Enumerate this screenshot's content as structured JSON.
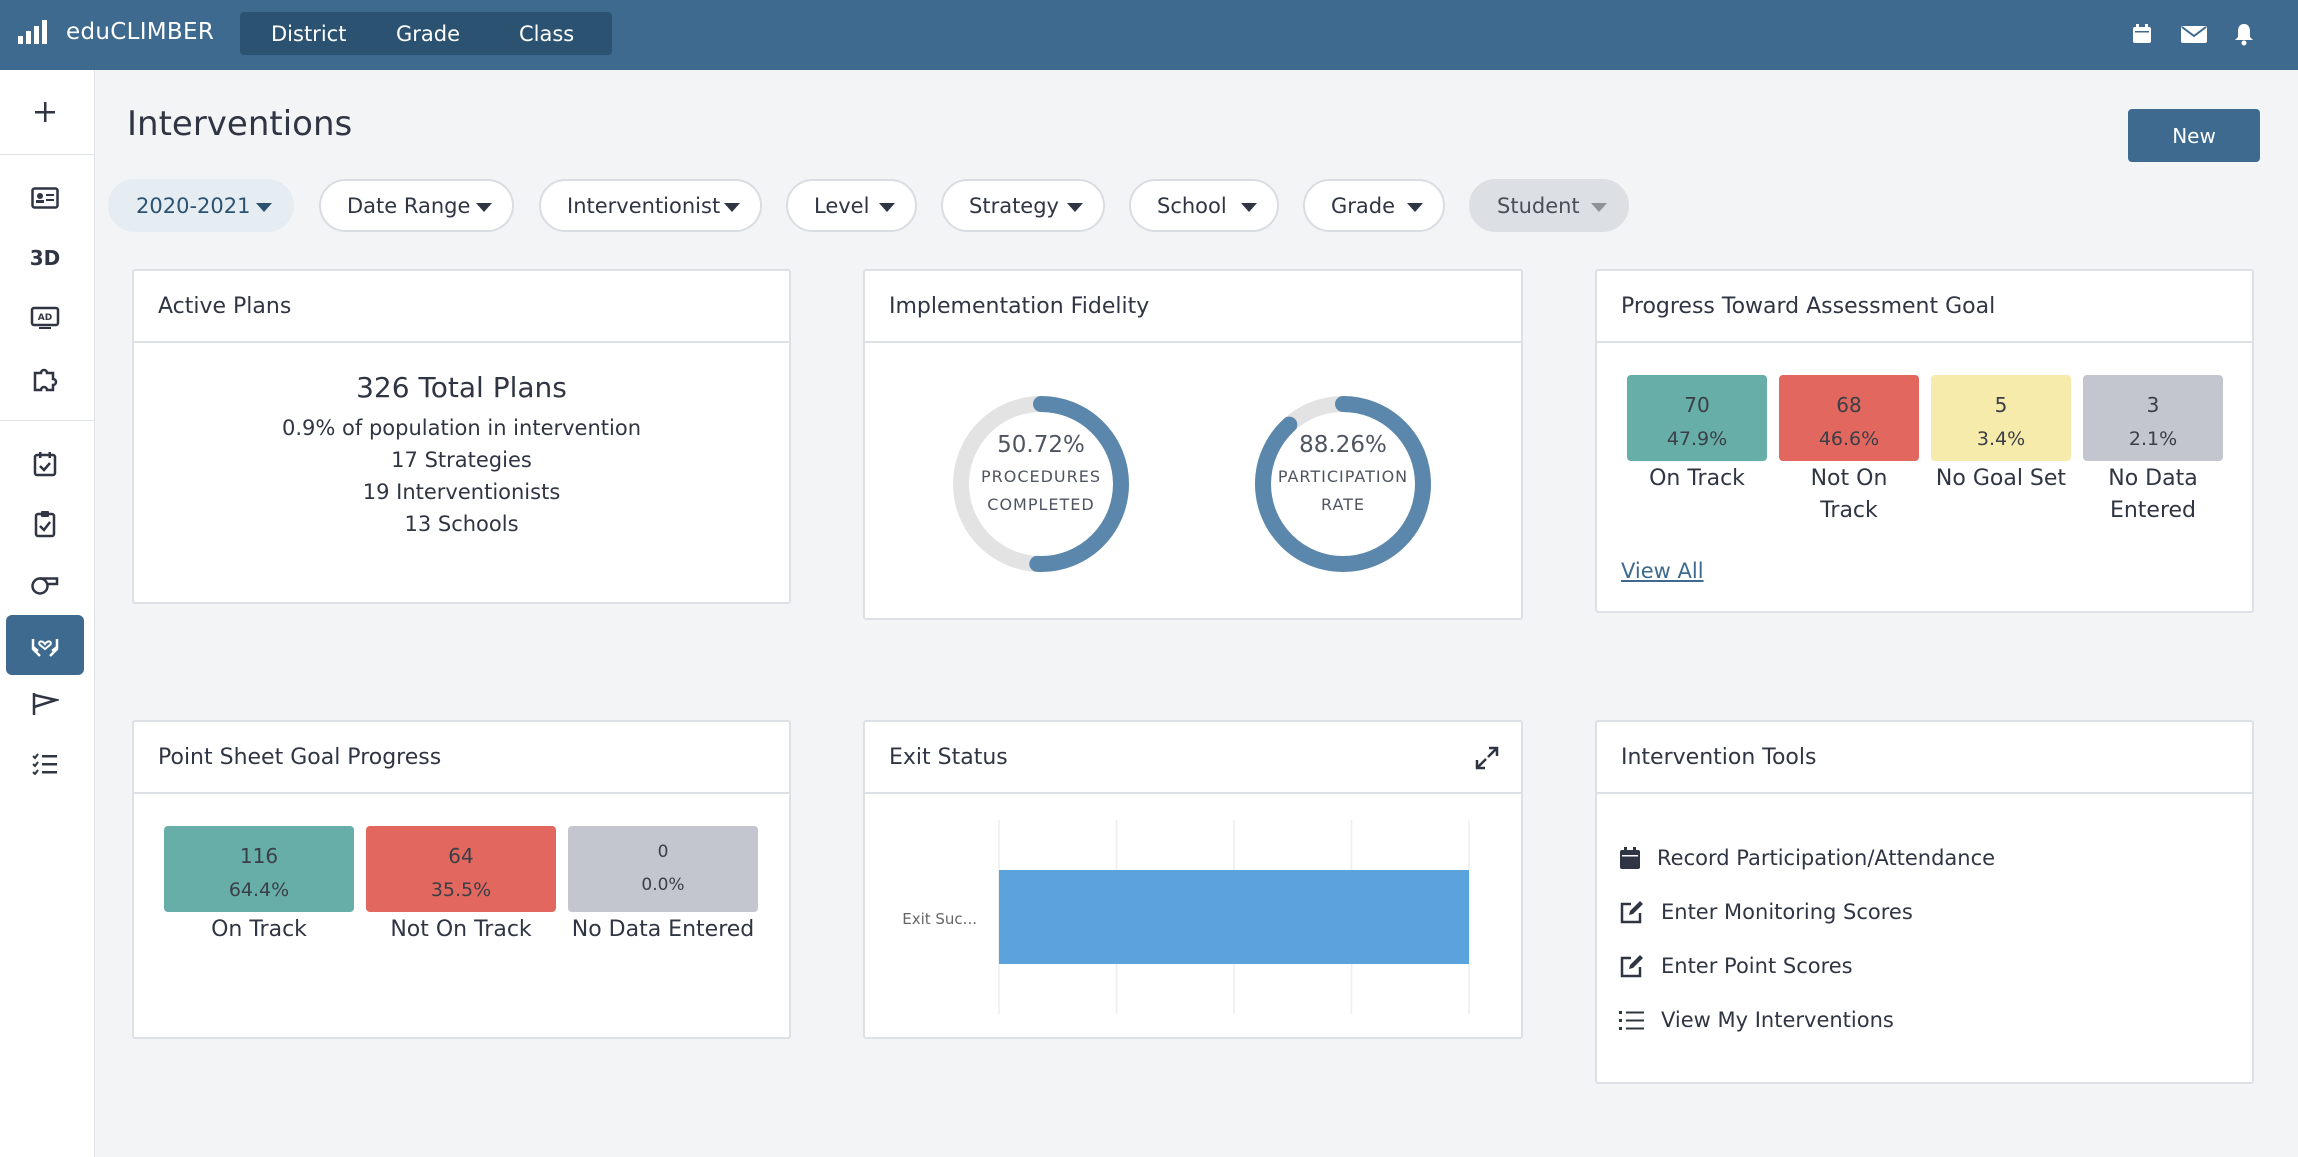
{
  "app": {
    "brand": "eduCLIMBER",
    "scope_tabs": [
      "District",
      "Grade",
      "Class"
    ],
    "top_icons": [
      "calendar-icon",
      "mail-icon",
      "bell-icon"
    ]
  },
  "sidebar": {
    "items": [
      {
        "name": "add",
        "icon": "plus-icon"
      },
      {
        "name": "student-profile",
        "icon": "id-card-icon"
      },
      {
        "name": "3d",
        "label": "3D"
      },
      {
        "name": "ad-display",
        "icon": "ad-screen-icon"
      },
      {
        "name": "puzzle",
        "icon": "puzzle-icon"
      },
      {
        "name": "calendar",
        "icon": "calendar-check-icon"
      },
      {
        "name": "clipboard",
        "icon": "clipboard-icon"
      },
      {
        "name": "whistle",
        "icon": "whistle-icon"
      },
      {
        "name": "interventions",
        "icon": "hands-heart-icon",
        "active": true
      },
      {
        "name": "flag",
        "icon": "flag-icon"
      },
      {
        "name": "checklist",
        "icon": "checklist-icon"
      }
    ]
  },
  "header": {
    "title": "Interventions",
    "new_label": "New"
  },
  "filters": {
    "year": "2020-2021",
    "date_range": "Date Range",
    "interventionist": "Interventionist",
    "level": "Level",
    "strategy": "Strategy",
    "school": "School",
    "grade": "Grade",
    "student": "Student"
  },
  "active_plans": {
    "title": "Active Plans",
    "total": "326 Total Plans",
    "lines": [
      "0.9% of population in intervention",
      "17 Strategies",
      "19 Interventionists",
      "13 Schools"
    ]
  },
  "fidelity": {
    "title": "Implementation Fidelity",
    "donuts": [
      {
        "value": 50.72,
        "pct": "50.72%",
        "line1": "PROCEDURES",
        "line2": "COMPLETED"
      },
      {
        "value": 88.26,
        "pct": "88.26%",
        "line1": "PARTICIPATION",
        "line2": "RATE"
      }
    ],
    "colors": {
      "fill": "#5b87ac",
      "track": "#e3e3e3"
    }
  },
  "assessment": {
    "title": "Progress Toward Assessment Goal",
    "items": [
      {
        "count": "70",
        "pct": "47.9%",
        "label_1": "On Track",
        "label_2": "",
        "color": "#67ada8"
      },
      {
        "count": "68",
        "pct": "46.6%",
        "label_1": "Not On",
        "label_2": "Track",
        "color": "#e2675e"
      },
      {
        "count": "5",
        "pct": "3.4%",
        "label_1": "No Goal Set",
        "label_2": "",
        "color": "#f7ebab"
      },
      {
        "count": "3",
        "pct": "2.1%",
        "label_1": "No Data",
        "label_2": "Entered",
        "color": "#c3c5cf"
      }
    ],
    "view_all": "View All"
  },
  "point_sheet": {
    "title": "Point Sheet Goal Progress",
    "items": [
      {
        "count": "116",
        "pct": "64.4%",
        "label": "On Track",
        "color": "#67ada8"
      },
      {
        "count": "64",
        "pct": "35.5%",
        "label": "Not On Track",
        "color": "#e2675e"
      },
      {
        "count": "0",
        "pct": "0.0%",
        "label": "No Data Entered",
        "color": "#c3c5cf"
      }
    ]
  },
  "exit_status": {
    "title": "Exit Status",
    "expand_icon": "expand-icon"
  },
  "chart_data": {
    "type": "bar",
    "orientation": "horizontal",
    "categories": [
      "Exit Suc..."
    ],
    "values": [
      1
    ],
    "xlim": [
      0,
      1
    ],
    "grid": true,
    "color": "#5ba3dc"
  },
  "tools": {
    "title": "Intervention Tools",
    "items": [
      {
        "label": "Record Participation/Attendance",
        "icon": "calendar-icon"
      },
      {
        "label": "Enter Monitoring Scores",
        "icon": "edit-icon"
      },
      {
        "label": "Enter Point Scores",
        "icon": "edit-icon"
      },
      {
        "label": "View My Interventions",
        "icon": "list-icon"
      }
    ]
  }
}
